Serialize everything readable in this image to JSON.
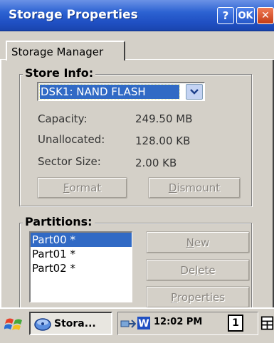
{
  "window": {
    "title": "Storage Properties",
    "help_label": "?",
    "ok_label": "OK",
    "close_label": "✕"
  },
  "tab": {
    "label": "Storage Manager"
  },
  "store_info": {
    "group_label": "Store Info:",
    "selected_store": "DSK1: NAND FLASH",
    "rows": [
      {
        "label": "Capacity:",
        "value": "249.50 MB"
      },
      {
        "label": "Unallocated:",
        "value": "128.00 KB"
      },
      {
        "label": "Sector Size:",
        "value": "2.00 KB"
      }
    ],
    "format_label": "Format",
    "format_mnemonic": "F",
    "format_rest": "ormat",
    "dismount_mnemonic": "D",
    "dismount_rest": "ismount"
  },
  "partitions": {
    "group_label": "Partitions:",
    "items": [
      "Part00 *",
      "Part01 *",
      "Part02 *"
    ],
    "new_mnemonic": "N",
    "new_rest": "ew",
    "delete_pre": "De",
    "delete_mnemonic": "l",
    "delete_post": "ete",
    "properties_mnemonic": "P",
    "properties_rest": "roperties"
  },
  "taskbar": {
    "task_label": "Stora...",
    "clock": "12:02 PM",
    "desktop_number": "1"
  },
  "icons": {
    "start": "windows-flag-icon",
    "task": "storage-disk-icon",
    "network": "network-icon",
    "word": "word-icon",
    "keyboard": "input-panel-icon"
  },
  "colors": {
    "title_bar": "#2c62d2",
    "selection": "#316ac5",
    "face": "#d4d0c8"
  }
}
